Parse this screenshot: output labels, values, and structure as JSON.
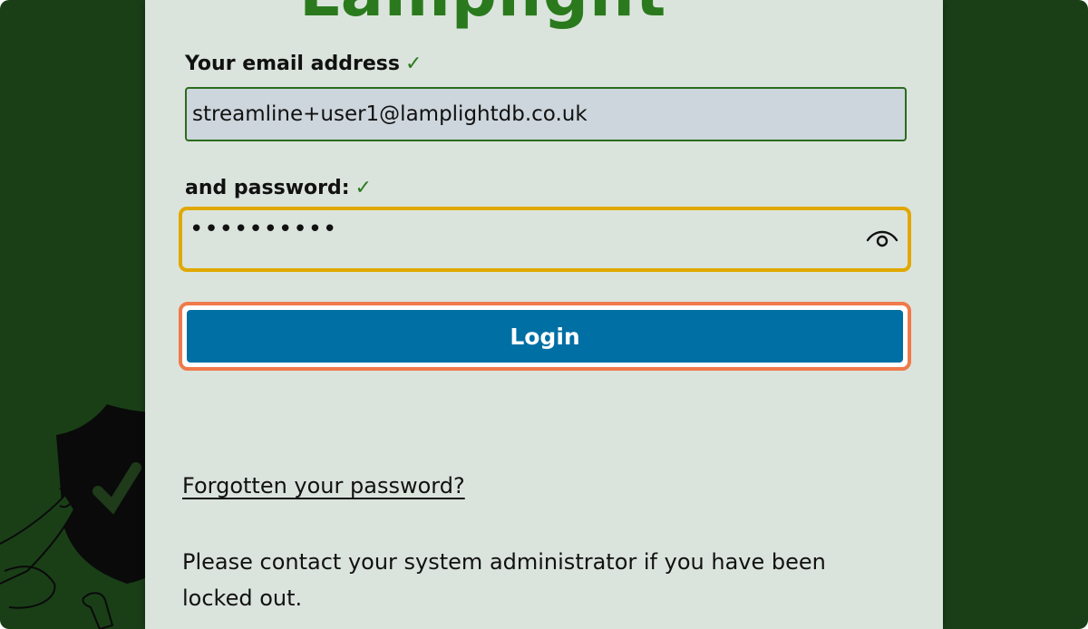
{
  "app": {
    "logo_text": "Lamplight"
  },
  "form": {
    "email_label": "Your email address",
    "email_check": "✓",
    "email_value": "streamline+user1@lamplightdb.co.uk",
    "password_label": "and password:",
    "password_check": "✓",
    "password_masked": "••••••••••",
    "show_password_icon": "eye-icon",
    "login_label": "Login"
  },
  "links": {
    "forgot_password": "Forgotten your password?"
  },
  "messages": {
    "locked_out": "Please contact your system administrator if you have been locked out."
  },
  "colors": {
    "background": "#1a3f17",
    "panel": "#dbe4dc",
    "brand_green": "#2a7a1d",
    "login_button": "#006fa3",
    "focus_password": "#e0a800",
    "focus_login": "#f07a4a"
  }
}
